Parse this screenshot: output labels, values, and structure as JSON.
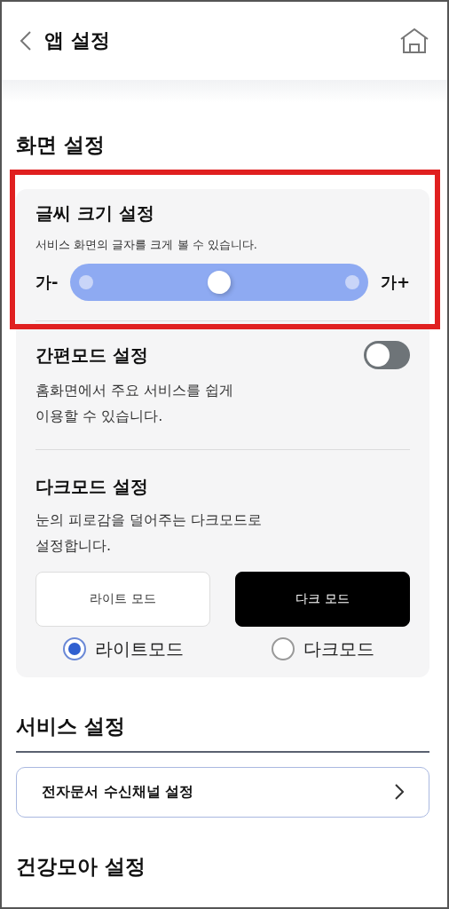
{
  "header": {
    "title": "앱 설정"
  },
  "display_section": {
    "title": "화면 설정",
    "font_size": {
      "title": "글씨 크기 설정",
      "description": "서비스 화면의 글자를 크게 볼 수 있습니다.",
      "min_label": "가-",
      "max_label": "가+",
      "level": 0.5,
      "highlighted": true
    },
    "simple_mode": {
      "title": "간편모드 설정",
      "description": "홈화면에서 주요 서비스를 쉽게\n이용할 수 있습니다.",
      "on": false
    },
    "dark_mode": {
      "title": "다크모드 설정",
      "description": "눈의 피로감을 덜어주는 다크모드로\n설정합니다.",
      "options": [
        {
          "preview": "라이트 모드",
          "label": "라이트모드",
          "kind": "light",
          "selected": true
        },
        {
          "preview": "다크 모드",
          "label": "다크모드",
          "kind": "dark",
          "selected": false
        }
      ]
    }
  },
  "service_section": {
    "title": "서비스 설정",
    "items": [
      "전자문서 수신채널 설정"
    ]
  },
  "health_section": {
    "title": "건강모아 설정"
  }
}
